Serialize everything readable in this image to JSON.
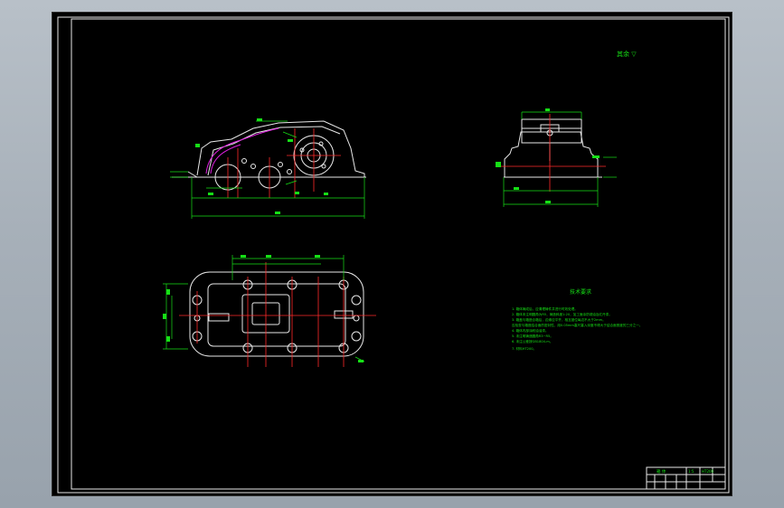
{
  "drawing": {
    "roughness_symbol": "其余 ▽",
    "tech_requirements": {
      "title": "技术要求",
      "items": [
        "1. 箱体铸成后，应清理铸件并进行时效处理。",
        "2. 箱体未注明圆角为R5，铸造斜度1:20，加工面涂防锈油及红丹漆。",
        "3. 箱盖与箱座合箱后，边缘应平齐，相互错位每边不大于2mm。",
        "   应检查与箱座结合面的密封性，用0.05mm塞尺塞入深度不得大于结合面宽度的三分之一。",
        "4. 箱体内部涂耐油油漆。",
        "5. 未注明铸造圆角R3~R5。",
        "6. 未注公差按GB1804-m。",
        "7. 材料HT200。"
      ]
    },
    "title_block": {
      "name_cell": "箱 体",
      "scale_cell": "1:5",
      "material_cell": "HT200"
    }
  },
  "colors": {
    "background": "#000000",
    "outline": "#e8e8e8",
    "centerline": "#ff2a2a",
    "dimension": "#16e016",
    "highlight": "#e020e0",
    "app_chrome": "#a7b0b9"
  }
}
